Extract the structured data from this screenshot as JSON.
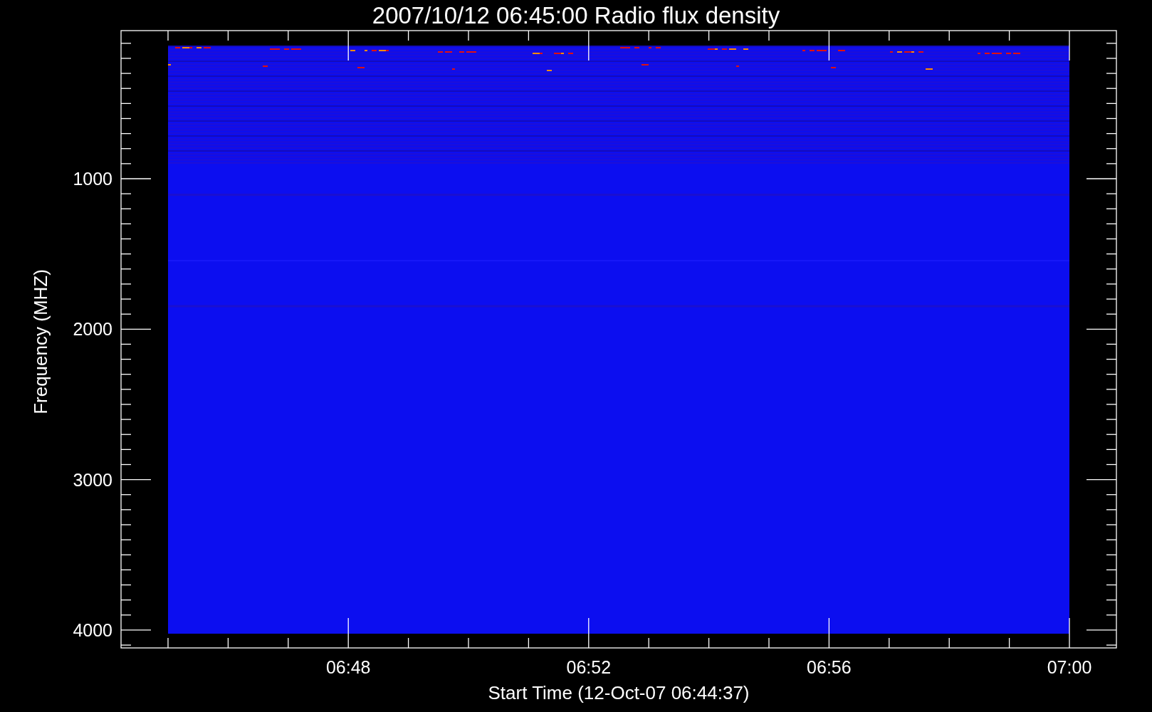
{
  "title": "2007/10/12 06:45:00 Radio flux density",
  "y_axis": {
    "label": "Frequency (MHZ)",
    "ticks": [
      "1000",
      "2000",
      "3000",
      "4000"
    ]
  },
  "x_axis": {
    "label": "Start Time (12-Oct-07 06:44:37)",
    "ticks": [
      "06:48",
      "06:52",
      "06:56",
      "07:00"
    ]
  }
}
